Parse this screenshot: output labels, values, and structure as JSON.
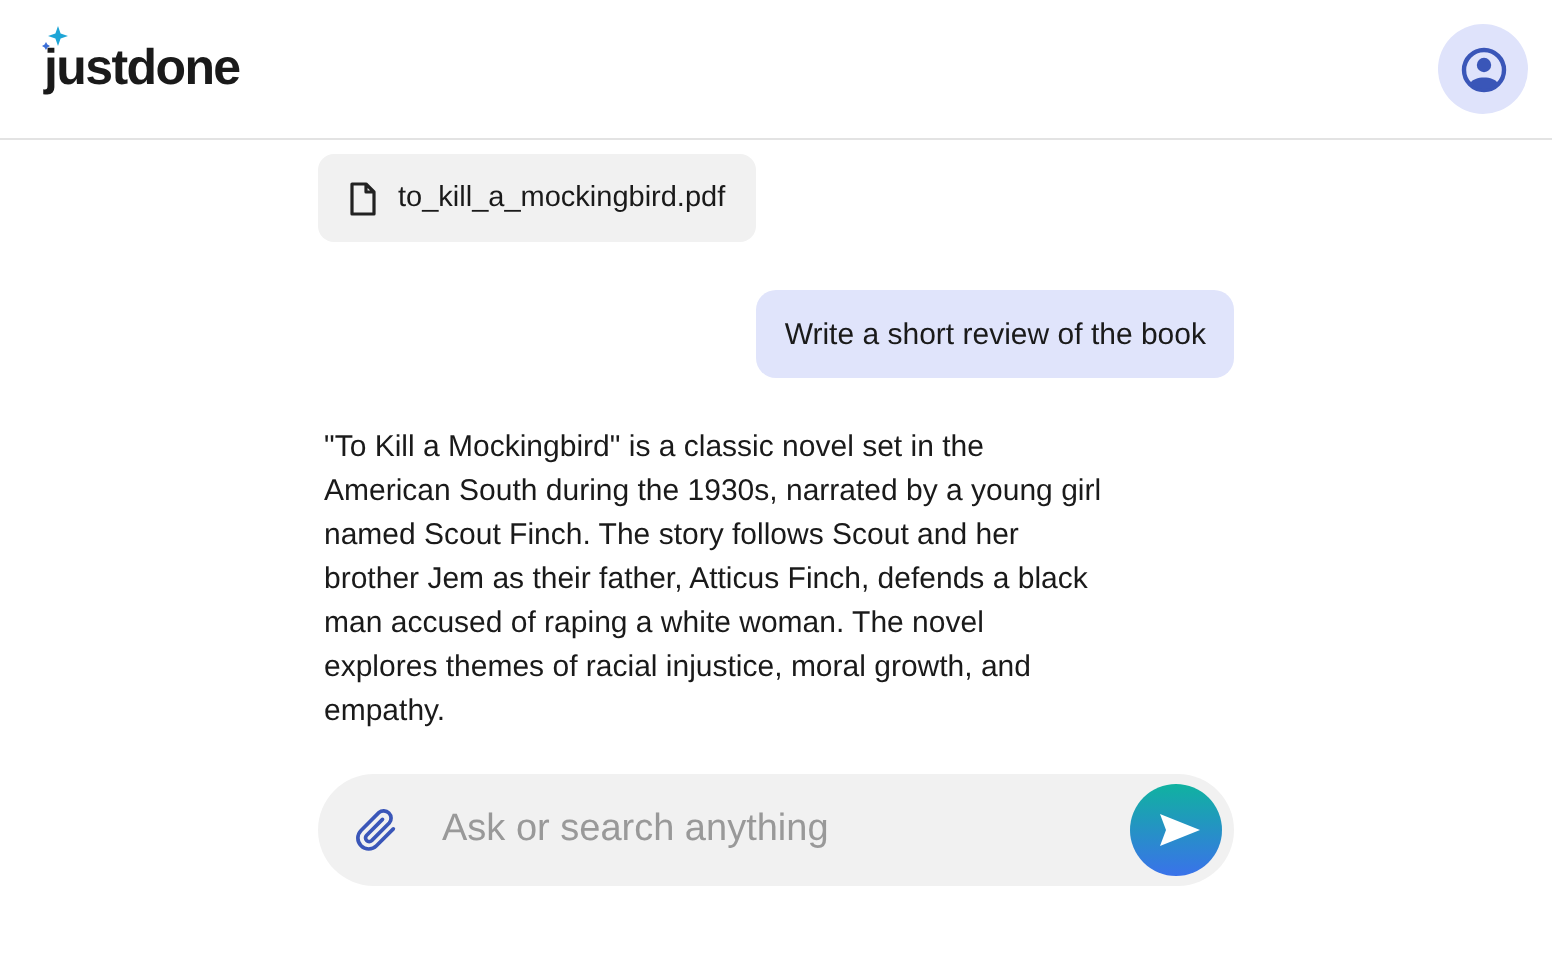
{
  "header": {
    "logo": "justdone"
  },
  "messages": [
    {
      "kind": "file",
      "text": "to_kill_a_mockingbird.pdf"
    },
    {
      "kind": "user",
      "text": "Write a short review of the book"
    },
    {
      "kind": "assistant",
      "text": "\"To Kill a Mockingbird\" is a classic novel set in the American South during the 1930s, narrated by a young girl named Scout Finch. The story follows Scout and her brother Jem as their father, Atticus Finch, defends a black man accused of raping a white woman. The novel explores themes of racial injustice, moral growth, and empathy."
    }
  ],
  "composer": {
    "placeholder": "Ask or search anything"
  }
}
